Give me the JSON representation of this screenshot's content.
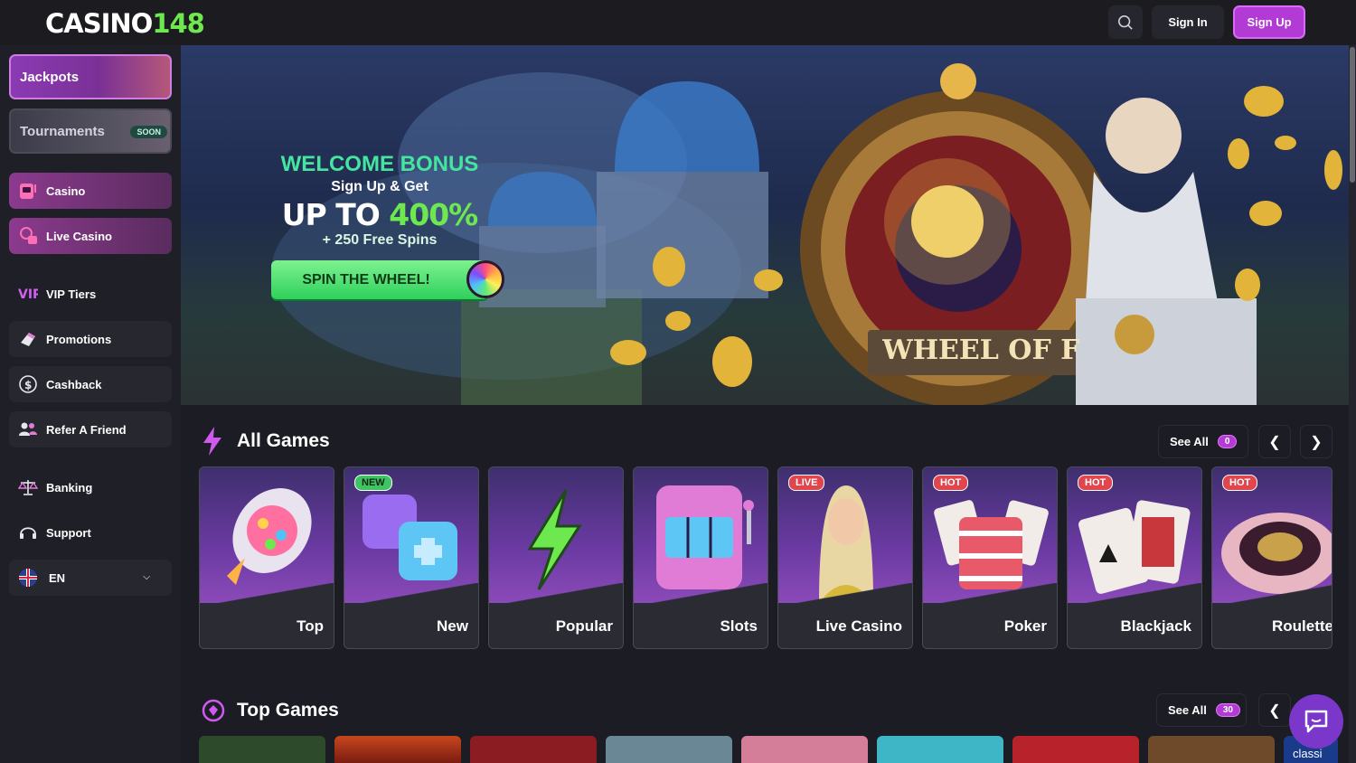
{
  "header": {
    "logo_text": "CASINO",
    "logo_number": "148",
    "signin_label": "Sign In",
    "signup_label": "Sign Up",
    "search_icon": "search-icon"
  },
  "sidebar": {
    "promos": [
      {
        "label": "Jackpots"
      },
      {
        "label": "Tournaments",
        "badge": "SOON"
      }
    ],
    "primary": [
      {
        "label": "Casino",
        "icon": "slot-machine-icon"
      },
      {
        "label": "Live Casino",
        "icon": "live-dealer-icon"
      }
    ],
    "items": [
      {
        "label": "VIP Tiers",
        "icon": "vip-icon"
      },
      {
        "label": "Promotions",
        "icon": "gift-icon"
      },
      {
        "label": "Cashback",
        "icon": "dollar-circle-icon"
      },
      {
        "label": "Refer A Friend",
        "icon": "users-icon"
      },
      {
        "label": "Banking",
        "icon": "scales-icon"
      },
      {
        "label": "Support",
        "icon": "headset-icon"
      }
    ],
    "language": {
      "label": "EN",
      "icon": "uk-flag-icon"
    }
  },
  "hero": {
    "welcome": "WELCOME BONUS",
    "signup_get": "Sign Up & Get",
    "up_to": "UP TO",
    "percent": "400%",
    "free_spins": "+ 250 Free Spins",
    "cta": "SPIN THE WHEEL!",
    "wheel_sign": "WHEEL OF FORE"
  },
  "all_games": {
    "title": "All Games",
    "see_all": "See All",
    "count": "0",
    "tiles": [
      {
        "label": "Top",
        "tag": ""
      },
      {
        "label": "New",
        "tag": "NEW"
      },
      {
        "label": "Popular",
        "tag": ""
      },
      {
        "label": "Slots",
        "tag": ""
      },
      {
        "label": "Live Casino",
        "tag": "LIVE"
      },
      {
        "label": "Poker",
        "tag": "HOT"
      },
      {
        "label": "Blackjack",
        "tag": "HOT"
      },
      {
        "label": "Roulette",
        "tag": "HOT"
      }
    ]
  },
  "top_games": {
    "title": "Top Games",
    "see_all": "See All",
    "count": "30",
    "partial_text": "classi"
  },
  "colors": {
    "accent": "#b23bd6",
    "green": "#6ee84f"
  }
}
